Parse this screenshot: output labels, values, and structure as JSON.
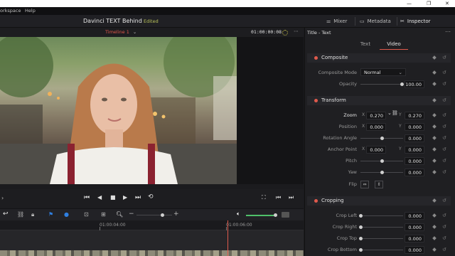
{
  "menu": {
    "workspace": "orkspace",
    "help": "Help"
  },
  "header": {
    "project_name": "Davinci TEXT Behind",
    "status": "Edited",
    "mixer": "Mixer",
    "metadata": "Metadata",
    "inspector": "Inspector"
  },
  "viewer": {
    "timeline_name": "Timeline 1",
    "timecode": "01:00:00:08"
  },
  "timeline": {
    "ruler_marks": [
      "01:00:04:00",
      "01:00:06:00"
    ]
  },
  "inspector": {
    "title": "Title - Text",
    "tabs": [
      "Text",
      "Video"
    ],
    "active_tab": "Video",
    "composite": {
      "label": "Composite",
      "mode_label": "Composite Mode",
      "mode_value": "Normal",
      "opacity_label": "Opacity",
      "opacity_value": "100.00"
    },
    "transform": {
      "label": "Transform",
      "zoom_label": "Zoom",
      "zoom_x": "0.270",
      "zoom_y": "0.270",
      "position_label": "Position",
      "position_x": "0.000",
      "position_y": "0.000",
      "rotation_label": "Rotation Angle",
      "rotation_value": "0.000",
      "anchor_label": "Anchor Point",
      "anchor_x": "0.000",
      "anchor_y": "0.000",
      "pitch_label": "Pitch",
      "pitch_value": "0.000",
      "yaw_label": "Yaw",
      "yaw_value": "0.000",
      "flip_label": "Flip"
    },
    "cropping": {
      "label": "Cropping",
      "crop_left_label": "Crop Left",
      "crop_left": "0.000",
      "crop_right_label": "Crop Right",
      "crop_right": "0.000",
      "crop_top_label": "Crop Top",
      "crop_top": "0.000",
      "crop_bottom_label": "Crop Bottom",
      "crop_bottom": "0.000"
    },
    "axis_x": "X",
    "axis_y": "Y"
  },
  "colors": {
    "accent_red": "#e05a4c",
    "edited_green": "#b9c25b",
    "audio_green": "#4fc06a",
    "flag_blue": "#2f7fe0"
  }
}
